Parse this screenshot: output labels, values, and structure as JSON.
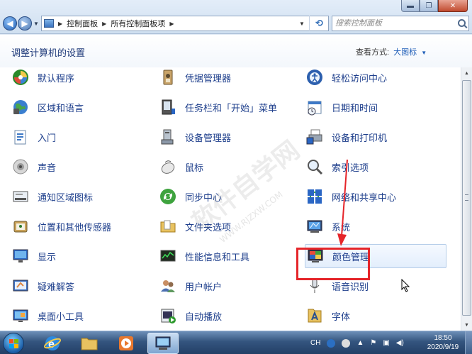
{
  "window": {
    "min_label": "▬",
    "max_label": "❐",
    "close_label": "✕"
  },
  "address_bar": {
    "breadcrumbs": [
      "控制面板",
      "所有控制面板项"
    ],
    "search_placeholder": "搜索控制面板"
  },
  "header": {
    "title": "调整计算机的设置",
    "view_by_label": "查看方式:",
    "view_by_value": "大图标"
  },
  "items": [
    {
      "label": "默认程序",
      "icon": "default-programs-icon"
    },
    {
      "label": "凭据管理器",
      "icon": "credential-manager-icon"
    },
    {
      "label": "轻松访问中心",
      "icon": "ease-of-access-icon"
    },
    {
      "label": "区域和语言",
      "icon": "region-language-icon"
    },
    {
      "label": "任务栏和「开始」菜单",
      "icon": "taskbar-start-menu-icon"
    },
    {
      "label": "日期和时间",
      "icon": "date-time-icon"
    },
    {
      "label": "入门",
      "icon": "getting-started-icon"
    },
    {
      "label": "设备管理器",
      "icon": "device-manager-icon"
    },
    {
      "label": "设备和打印机",
      "icon": "devices-printers-icon"
    },
    {
      "label": "声音",
      "icon": "sound-icon"
    },
    {
      "label": "鼠标",
      "icon": "mouse-icon"
    },
    {
      "label": "索引选项",
      "icon": "indexing-options-icon"
    },
    {
      "label": "通知区域图标",
      "icon": "notification-area-icon"
    },
    {
      "label": "同步中心",
      "icon": "sync-center-icon"
    },
    {
      "label": "网络和共享中心",
      "icon": "network-sharing-icon"
    },
    {
      "label": "位置和其他传感器",
      "icon": "location-sensors-icon"
    },
    {
      "label": "文件夹选项",
      "icon": "folder-options-icon"
    },
    {
      "label": "系统",
      "icon": "system-icon"
    },
    {
      "label": "显示",
      "icon": "display-icon"
    },
    {
      "label": "性能信息和工具",
      "icon": "performance-icon"
    },
    {
      "label": "颜色管理",
      "icon": "color-management-icon"
    },
    {
      "label": "疑难解答",
      "icon": "troubleshooting-icon"
    },
    {
      "label": "用户帐户",
      "icon": "user-accounts-icon"
    },
    {
      "label": "语音识别",
      "icon": "speech-recognition-icon"
    },
    {
      "label": "桌面小工具",
      "icon": "desktop-gadgets-icon"
    },
    {
      "label": "自动播放",
      "icon": "autoplay-icon"
    },
    {
      "label": "字体",
      "icon": "fonts-icon"
    }
  ],
  "watermark": {
    "text": "软件自学网",
    "url": "WWW.RJZXW.COM"
  },
  "taskbar": {
    "apps": [
      "start-orb",
      "internet-explorer",
      "windows-explorer",
      "media-player",
      "control-panel"
    ],
    "tray_lang": "CH",
    "clock_time": "18:50",
    "clock_date": "2020/9/19"
  },
  "colors": {
    "link_text": "#1e3f8c",
    "highlight_box": "#e5252a",
    "arrow": "#e5252a"
  }
}
